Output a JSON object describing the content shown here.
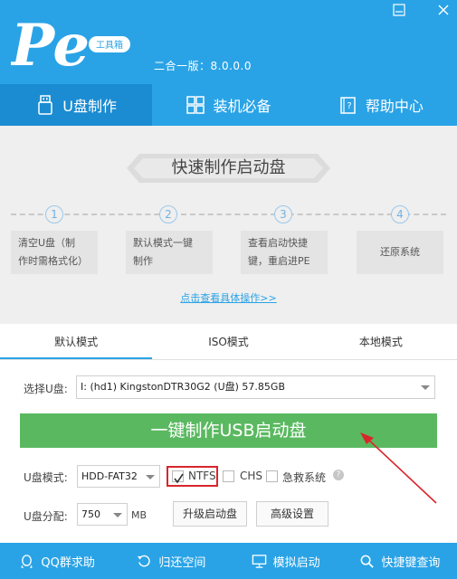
{
  "app": {
    "version": "二合一版：8.0.0.0",
    "logo_tag": "工具箱",
    "logo_text": "Pe"
  },
  "window": {
    "minimize_icon": "minimize-icon",
    "close_icon": "close-icon"
  },
  "main_tabs": [
    {
      "label": "U盘制作",
      "icon": "usb-icon",
      "active": true
    },
    {
      "label": "装机必备",
      "icon": "apps-grid-icon",
      "active": false
    },
    {
      "label": "帮助中心",
      "icon": "help-book-icon",
      "active": false
    }
  ],
  "guide": {
    "title": "快速制作启动盘",
    "steps": [
      {
        "num": "1",
        "line1": "清空U盘（制",
        "line2": "作时需格式化）"
      },
      {
        "num": "2",
        "line1": "默认模式一键",
        "line2": "制作"
      },
      {
        "num": "3",
        "line1": "查看启动快捷",
        "line2": "键，重启进PE"
      },
      {
        "num": "4",
        "line1": "还原系统",
        "line2": ""
      }
    ],
    "link": "点击查看具体操作>>"
  },
  "sub_tabs": [
    {
      "label": "默认模式",
      "active": true
    },
    {
      "label": "ISO模式",
      "active": false
    },
    {
      "label": "本地模式",
      "active": false
    }
  ],
  "form": {
    "usb_label": "选择U盘:",
    "usb_value": "I: (hd1) KingstonDTR30G2  (U盘) 57.85GB",
    "make_button": "一键制作USB启动盘",
    "mode_label": "U盘模式:",
    "mode_value": "HDD-FAT32",
    "ntfs_label": "NTFS",
    "ntfs_checked": true,
    "chs_label": "CHS",
    "chs_checked": false,
    "rescue_label": "急救系统",
    "rescue_checked": false,
    "help_mark": "?",
    "partition_label": "U盘分配:",
    "partition_value": "750",
    "partition_unit": "MB",
    "upgrade_button": "升级启动盘",
    "advanced_button": "高级设置"
  },
  "footer": [
    {
      "label": "QQ群求助",
      "icon": "qq-icon"
    },
    {
      "label": "归还空间",
      "icon": "restore-icon"
    },
    {
      "label": "模拟启动",
      "icon": "monitor-icon"
    },
    {
      "label": "快捷键查询",
      "icon": "search-icon"
    }
  ],
  "colors": {
    "brand": "#2aa3e6",
    "active_tab": "#1b8cd2",
    "make_button": "#5ab960",
    "highlight": "#d9262c"
  }
}
